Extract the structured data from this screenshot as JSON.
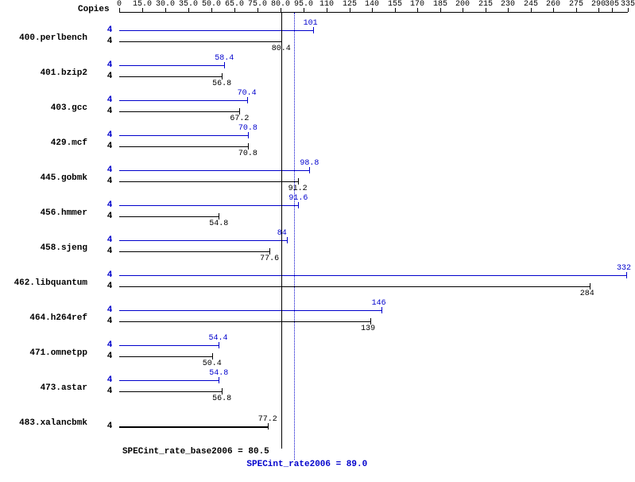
{
  "chart_data": {
    "type": "bar",
    "title": "",
    "xlabel": "",
    "ylabel": "",
    "xlim": [
      0,
      335
    ],
    "x_ticks": [
      0,
      15,
      30,
      35,
      50,
      65,
      75,
      80,
      95,
      110,
      125,
      140,
      155,
      170,
      185,
      200,
      215,
      230,
      245,
      260,
      275,
      290,
      305,
      335
    ],
    "copies_header": "Copies",
    "benchmarks": [
      {
        "name": "400.perlbench",
        "copies_peak": 4,
        "copies_base": 4,
        "peak": 101,
        "base": 80.4
      },
      {
        "name": "401.bzip2",
        "copies_peak": 4,
        "copies_base": 4,
        "peak": 58.4,
        "base": 56.8
      },
      {
        "name": "403.gcc",
        "copies_peak": 4,
        "copies_base": 4,
        "peak": 70.4,
        "base": 67.2
      },
      {
        "name": "429.mcf",
        "copies_peak": 4,
        "copies_base": 4,
        "peak": 70.8,
        "base": 70.8
      },
      {
        "name": "445.gobmk",
        "copies_peak": 4,
        "copies_base": 4,
        "peak": 98.8,
        "base": 91.2
      },
      {
        "name": "456.hmmer",
        "copies_peak": 4,
        "copies_base": 4,
        "peak": 91.6,
        "base": 54.8
      },
      {
        "name": "458.sjeng",
        "copies_peak": 4,
        "copies_base": 4,
        "peak": 84.0,
        "base": 77.6
      },
      {
        "name": "462.libquantum",
        "copies_peak": 4,
        "copies_base": 4,
        "peak": 332,
        "base": 284
      },
      {
        "name": "464.h264ref",
        "copies_peak": 4,
        "copies_base": 4,
        "peak": 146,
        "base": 139
      },
      {
        "name": "471.omnetpp",
        "copies_peak": 4,
        "copies_base": 4,
        "peak": 54.4,
        "base": 50.4
      },
      {
        "name": "473.astar",
        "copies_peak": 4,
        "copies_base": 4,
        "peak": 54.8,
        "base": 56.8
      },
      {
        "name": "483.xalancbmk",
        "copies_peak": null,
        "copies_base": 4,
        "peak": null,
        "base": 77.2
      }
    ],
    "base_marker": {
      "label": "SPECint_rate_base2006 = 80.5",
      "value": 80.5
    },
    "peak_marker": {
      "label": "SPECint_rate2006 = 89.0",
      "value": 89.0
    },
    "display_ticks": [
      0,
      "15.0",
      "30.0",
      "35.0",
      "50.0",
      "65.0",
      "75.0",
      "80.0",
      "95.0",
      110,
      125,
      140,
      155,
      170,
      185,
      200,
      215,
      230,
      245,
      260,
      275,
      290,
      305,
      335
    ]
  }
}
